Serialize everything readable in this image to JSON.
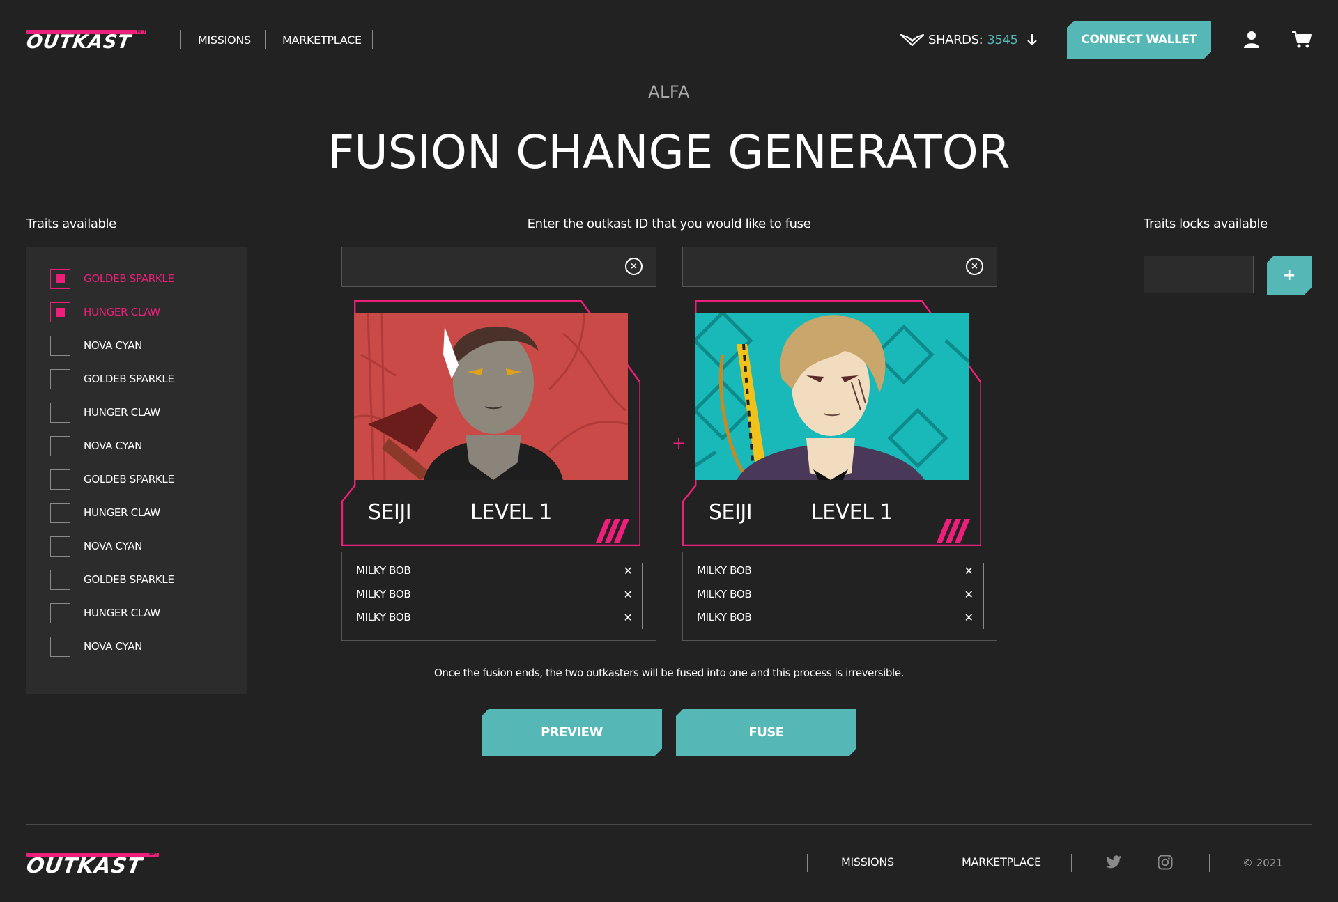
{
  "brand": {
    "logo_text": "OUTKAST",
    "logo_badge": "NFT"
  },
  "header": {
    "nav": [
      "MISSIONS",
      "MARKETPLACE"
    ],
    "shards_label": "SHARDS:",
    "shards_value": "3545",
    "connect_wallet": "CONNECT WALLET"
  },
  "page": {
    "subtitle": "ALFA",
    "title": "FUSION CHANGE GENERATOR"
  },
  "traits_panel": {
    "heading": "Traits available",
    "items": [
      {
        "label": "GOLDEB SPARKLE",
        "checked": true
      },
      {
        "label": "HUNGER CLAW",
        "checked": true
      },
      {
        "label": "NOVA CYAN",
        "checked": false
      },
      {
        "label": "GOLDEB SPARKLE",
        "checked": false
      },
      {
        "label": "HUNGER CLAW",
        "checked": false
      },
      {
        "label": "NOVA CYAN",
        "checked": false
      },
      {
        "label": "GOLDEB SPARKLE",
        "checked": false
      },
      {
        "label": "HUNGER CLAW",
        "checked": false
      },
      {
        "label": "NOVA CYAN",
        "checked": false
      },
      {
        "label": "GOLDEB SPARKLE",
        "checked": false
      },
      {
        "label": "HUNGER CLAW",
        "checked": false
      },
      {
        "label": "NOVA CYAN",
        "checked": false
      }
    ]
  },
  "fusion": {
    "heading": "Enter the outkast ID that you would like to fuse",
    "input_left_value": "",
    "input_right_value": "",
    "plus": "+",
    "cards": [
      {
        "name": "SEIJI",
        "level": "LEVEL 1",
        "background": "#c94a47"
      },
      {
        "name": "SEIJI",
        "level": "LEVEL 1",
        "background": "#19b9b9"
      }
    ],
    "trait_lists": [
      [
        "MILKY BOB",
        "MILKY BOB",
        "MILKY BOB"
      ],
      [
        "MILKY BOB",
        "MILKY BOB",
        "MILKY BOB"
      ]
    ],
    "notice": "Once the fusion ends, the two outkasters will be fused into one and this process is irreversible.",
    "preview_button": "PREVIEW",
    "fuse_button": "FUSE"
  },
  "locks": {
    "heading": "Traits locks available",
    "input_value": "",
    "add_button": "+"
  },
  "footer": {
    "nav": [
      "MISSIONS",
      "MARKETPLACE"
    ],
    "copyright": "© 2021"
  },
  "colors": {
    "background": "#222223",
    "panel": "#2c2c2d",
    "accent_pink": "#ee1f7a",
    "accent_teal": "#56b8b6"
  },
  "icons": [
    "shard-wing-icon",
    "arrow-down-icon",
    "user-icon",
    "cart-icon",
    "clear-circle-icon",
    "close-x-icon",
    "twitter-icon",
    "instagram-icon"
  ]
}
